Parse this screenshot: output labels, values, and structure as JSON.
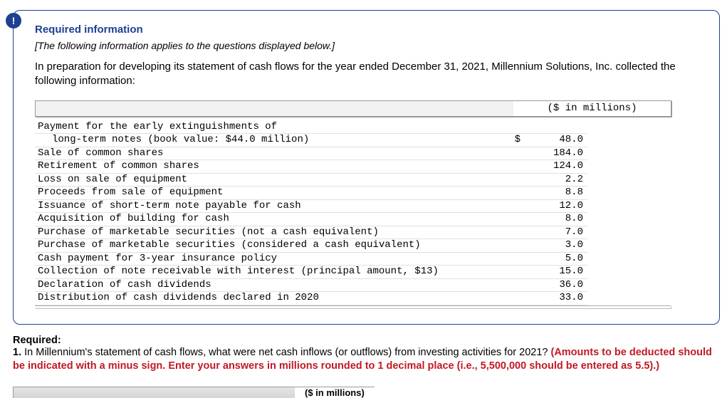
{
  "badge": "!",
  "card": {
    "title": "Required information",
    "note": "[The following information applies to the questions displayed below.]",
    "intro": "In preparation for developing its statement of cash flows for the year ended December 31, 2021, Millennium Solutions, Inc. collected the following information:",
    "col_header": "($ in millions)",
    "rows": [
      {
        "label": "Payment for the early extinguishments of",
        "value": "",
        "prefix": "",
        "indent": false
      },
      {
        "label": "long-term notes (book value: $44.0 million)",
        "value": "48.0",
        "prefix": "$",
        "indent": true
      },
      {
        "label": "Sale of common shares",
        "value": "184.0",
        "prefix": "",
        "indent": false
      },
      {
        "label": "Retirement of common shares",
        "value": "124.0",
        "prefix": "",
        "indent": false
      },
      {
        "label": "Loss on sale of equipment",
        "value": "2.2",
        "prefix": "",
        "indent": false
      },
      {
        "label": "Proceeds from sale of equipment",
        "value": "8.8",
        "prefix": "",
        "indent": false
      },
      {
        "label": "Issuance of short-term note payable for cash",
        "value": "12.0",
        "prefix": "",
        "indent": false
      },
      {
        "label": "Acquisition of building for cash",
        "value": "8.0",
        "prefix": "",
        "indent": false
      },
      {
        "label": "Purchase of marketable securities (not a cash equivalent)",
        "value": "7.0",
        "prefix": "",
        "indent": false
      },
      {
        "label": "Purchase of marketable securities (considered a cash equivalent)",
        "value": "3.0",
        "prefix": "",
        "indent": false
      },
      {
        "label": "Cash payment for 3-year insurance policy",
        "value": "5.0",
        "prefix": "",
        "indent": false
      },
      {
        "label": "Collection of note receivable with interest (principal amount, $13)",
        "value": "15.0",
        "prefix": "",
        "indent": false
      },
      {
        "label": "Declaration of cash dividends",
        "value": "36.0",
        "prefix": "",
        "indent": false
      },
      {
        "label": "Distribution of cash dividends declared in 2020",
        "value": "33.0",
        "prefix": "",
        "indent": false
      }
    ]
  },
  "required": {
    "heading": "Required:",
    "q_prefix": "1. ",
    "q_plain": "In Millennium's statement of cash flows, what were net cash inflows (or outflows) from investing activities for 2021? ",
    "q_highlight": "(Amounts to be deducted should be indicated with a minus sign. Enter your answers in millions rounded to 1 decimal place (i.e., 5,500,000 should be entered as 5.5).)"
  },
  "footer_label": "($ in millions)"
}
